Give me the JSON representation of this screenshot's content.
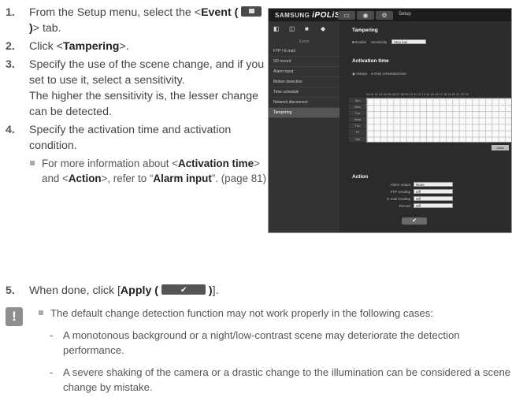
{
  "steps": [
    {
      "num": "1.",
      "pre": "From the Setup menu, select the <",
      "bold": "Event (",
      "bold2": ")",
      "post": "> tab."
    },
    {
      "num": "2.",
      "pre": "Click <",
      "bold": "Tampering",
      "post": ">."
    },
    {
      "num": "3.",
      "text": "Specify the use of the scene change, and if you set to use it, select a sensitivity.",
      "text2": "The higher the sensitivity is, the lesser change can be detected."
    },
    {
      "num": "4.",
      "text": "Specify the activation time and activation condition.",
      "sub": {
        "p1": "For more information about <",
        "b1": "Activation time",
        "p2": "> and <",
        "b2": "Action",
        "p3": ">, refer to “",
        "b3": "Alarm input",
        "p4": "”. (page 81)"
      }
    },
    {
      "num": "5.",
      "pre": "When done, click [",
      "bold": "Apply (",
      "bold2": ")",
      "post": "]."
    }
  ],
  "screenshot": {
    "logo_prefix": "SAMSUNG",
    "logo_main": "iPOLiS",
    "setup_label": "Setup",
    "nav_header": "Event",
    "nav_items": [
      "FTP / E-mail",
      "SD record",
      "Alarm input",
      "Motion detection",
      "Time schedule",
      "Network disconnect",
      "Tampering"
    ],
    "tampering_title": "Tampering",
    "enable_label": "Enable",
    "sensitivity_label": "Sensitivity",
    "sensitivity_value": "Very low",
    "activation_title": "Activation time",
    "radio_always": "Always",
    "radio_scheduled": "Only scheduled time",
    "hours": "00 01 02 03 04 05 06 07 08 09 10 11 12 13 14 15 16 17 18 19 20 21 22 23",
    "days": [
      "Sun",
      "Mon",
      "Tue",
      "Wed",
      "Thu",
      "Fri",
      "Sat"
    ],
    "clear_label": "Clear",
    "action_title": "Action",
    "action_rows": [
      {
        "label": "Alarm output",
        "value": "None"
      },
      {
        "label": "FTP sending",
        "value": "Off"
      },
      {
        "label": "E-mail sending",
        "value": "Off"
      },
      {
        "label": "Record",
        "value": "Off"
      }
    ],
    "apply_glyph": "✔"
  },
  "note": {
    "icon": "!",
    "intro": "The default change detection function may not work properly in the following cases:",
    "items": [
      "A monotonous background or a night/low-contrast scene may deteriorate the detection performance.",
      "A severe shaking of the camera or a drastic change to the illumination can be considered a scene change by mistake."
    ]
  }
}
